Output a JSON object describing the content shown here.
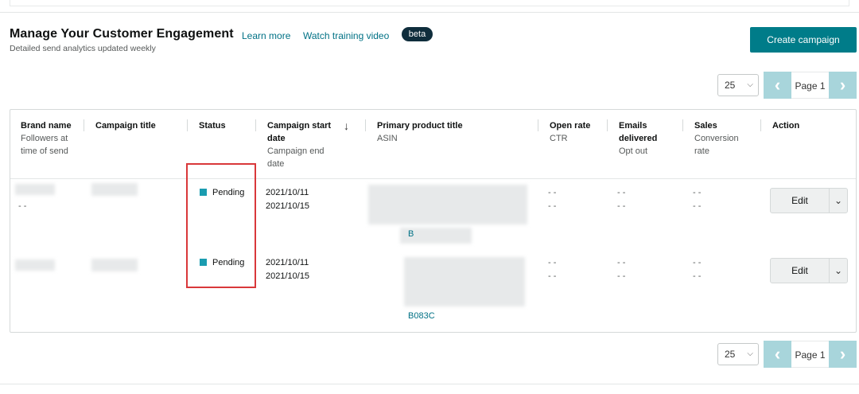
{
  "header": {
    "title": "Manage Your Customer Engagement",
    "learn_more": "Learn more",
    "watch_video": "Watch training video",
    "beta": "beta",
    "subtitle": "Detailed send analytics updated weekly"
  },
  "toolbar": {
    "create_campaign": "Create campaign"
  },
  "pagination": {
    "page_size": "25",
    "page_label": "Page 1",
    "caret": "⌵",
    "prev": "‹",
    "next": "›"
  },
  "table": {
    "columns": [
      {
        "main": "Brand name",
        "sub": [
          "Followers at",
          "time of send"
        ]
      },
      {
        "main": "Campaign title",
        "sub": []
      },
      {
        "main": "Status",
        "sub": []
      },
      {
        "main": "Campaign start",
        "main2": "date",
        "sub": [
          "Campaign end",
          "date"
        ]
      },
      {
        "main": "Primary product title",
        "sub": [
          "ASIN"
        ]
      },
      {
        "main": "Open rate",
        "sub": [
          "CTR"
        ]
      },
      {
        "main": "Emails",
        "main2": "delivered",
        "sub": [
          "Opt out"
        ]
      },
      {
        "main": "Sales",
        "sub": [
          "Conversion",
          "rate"
        ]
      },
      {
        "main": "Action",
        "sub": []
      }
    ],
    "sort_icon": "↓",
    "rows": [
      {
        "followers": "- -",
        "status": "Pending",
        "start_date": "2021/10/11",
        "end_date": "2021/10/15",
        "product_lines": [
          "B"
        ],
        "open_rate": "- -",
        "ctr": "- -",
        "emails_delivered": "- -",
        "opt_out": "- -",
        "sales": "- -",
        "conversion": "- -",
        "edit_label": "Edit",
        "dropdown": "⌄"
      },
      {
        "followers": "",
        "status": "Pending",
        "start_date": "2021/10/11",
        "end_date": "2021/10/15",
        "product_lines": [
          "B083C"
        ],
        "open_rate": "- -",
        "ctr": "- -",
        "emails_delivered": "- -",
        "opt_out": "- -",
        "sales": "- -",
        "conversion": "- -",
        "edit_label": "Edit",
        "dropdown": "⌄"
      }
    ]
  },
  "colors": {
    "accent": "#007c89",
    "link": "#007185",
    "status_pending": "#1a9cb0",
    "highlight": "#d9383a",
    "pager_button": "#a8d5db"
  }
}
